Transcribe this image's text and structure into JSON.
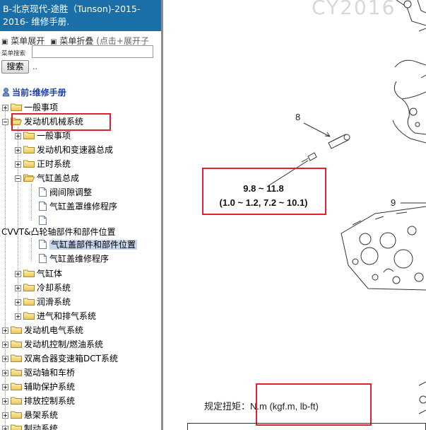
{
  "sidebar": {
    "title": "B-北京现代-途胜（Tunson)-2015-2016- 维修手册.",
    "menu": {
      "expand_icon": "▣",
      "expand_label": "菜单展开",
      "collapse_icon": "▣",
      "collapse_label": "菜单折叠",
      "hint": "(点击+展开子"
    },
    "search": {
      "label": "菜单搜索",
      "placeholder": "",
      "button_label": "搜索",
      "trailing": ".."
    },
    "current_label": "当前:维修手册",
    "tree": [
      {
        "label": "一般事项"
      },
      {
        "label": "发动机机械系统"
      },
      {
        "label": "一般事项"
      },
      {
        "label": "发动机和变速器总成"
      },
      {
        "label": "正时系统"
      },
      {
        "label": "气缸盖总成"
      },
      {
        "label": "阀间隙调整"
      },
      {
        "label": "气缸盖罩维修程序"
      },
      {
        "label": ""
      },
      {
        "label": "CVVT&凸轮轴部件和部件位置"
      },
      {
        "label": "气缸盖部件和部件位置"
      },
      {
        "label": "气缸盖维修程序"
      },
      {
        "label": "气缸体"
      },
      {
        "label": "冷却系统"
      },
      {
        "label": "润滑系统"
      },
      {
        "label": "进气和排气系统"
      },
      {
        "label": "发动机电气系统"
      },
      {
        "label": "发动机控制/燃油系统"
      },
      {
        "label": "双离合器变速箱DCT系统"
      },
      {
        "label": "驱动轴和车桥"
      },
      {
        "label": "辅助保护系统"
      },
      {
        "label": "排放控制系统"
      },
      {
        "label": "悬架系统"
      },
      {
        "label": "制动系统"
      }
    ]
  },
  "content": {
    "watermark": "CY2016",
    "callout_8": "8",
    "callout_9": "9",
    "torque_line1": "9.8 ~ 11.8",
    "torque_line2": "(1.0 ~ 1.2,  7.2 ~ 10.1)",
    "spec_label": "规定扭矩：",
    "spec_unit": "N.m (kgf.m, lb-ft)"
  },
  "colors": {
    "title_bg": "#1a6fa8",
    "highlight": "#e2202b",
    "selected_bg": "#c5d5ee",
    "link_blue": "#1a3fb0"
  }
}
